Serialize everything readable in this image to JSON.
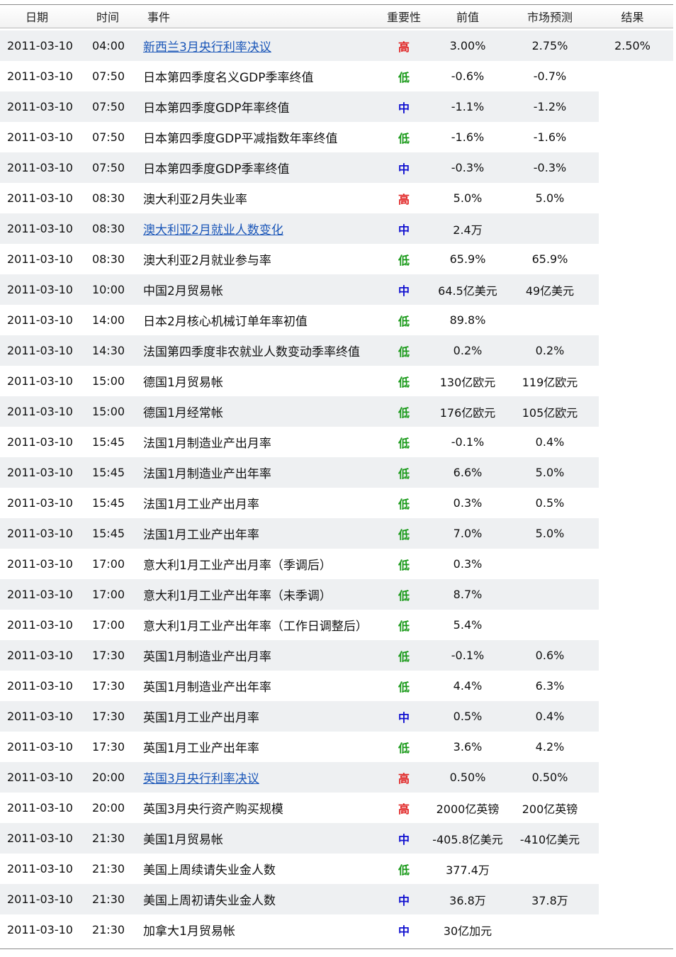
{
  "colors": {
    "high": "#e02020",
    "medium": "#1010d0",
    "low": "#1a9a1a",
    "link": "#1a56b8"
  },
  "columns": {
    "date": "日期",
    "time": "时间",
    "event": "事件",
    "importance": "重要性",
    "previous": "前值",
    "forecast": "市场预测",
    "result": "结果"
  },
  "rows": [
    {
      "date": "2011-03-10",
      "time": "04:00",
      "event": "新西兰3月央行利率决议",
      "link": true,
      "importance": "高",
      "level": "high",
      "previous": "3.00%",
      "forecast": "2.75%",
      "result": "2.50%"
    },
    {
      "date": "2011-03-10",
      "time": "07:50",
      "event": "日本第四季度名义GDP季率终值",
      "link": false,
      "importance": "低",
      "level": "low",
      "previous": "-0.6%",
      "forecast": "-0.7%",
      "result": ""
    },
    {
      "date": "2011-03-10",
      "time": "07:50",
      "event": "日本第四季度GDP年率终值",
      "link": false,
      "importance": "中",
      "level": "medium",
      "previous": "-1.1%",
      "forecast": "-1.2%",
      "result": ""
    },
    {
      "date": "2011-03-10",
      "time": "07:50",
      "event": "日本第四季度GDP平减指数年率终值",
      "link": false,
      "importance": "低",
      "level": "low",
      "previous": "-1.6%",
      "forecast": "-1.6%",
      "result": ""
    },
    {
      "date": "2011-03-10",
      "time": "07:50",
      "event": "日本第四季度GDP季率终值",
      "link": false,
      "importance": "中",
      "level": "medium",
      "previous": "-0.3%",
      "forecast": "-0.3%",
      "result": ""
    },
    {
      "date": "2011-03-10",
      "time": "08:30",
      "event": "澳大利亚2月失业率",
      "link": false,
      "importance": "高",
      "level": "high",
      "previous": "5.0%",
      "forecast": "5.0%",
      "result": ""
    },
    {
      "date": "2011-03-10",
      "time": "08:30",
      "event": "澳大利亚2月就业人数变化",
      "link": true,
      "importance": "中",
      "level": "medium",
      "previous": "2.4万",
      "forecast": "",
      "result": ""
    },
    {
      "date": "2011-03-10",
      "time": "08:30",
      "event": "澳大利亚2月就业参与率",
      "link": false,
      "importance": "低",
      "level": "low",
      "previous": "65.9%",
      "forecast": "65.9%",
      "result": ""
    },
    {
      "date": "2011-03-10",
      "time": "10:00",
      "event": "中国2月贸易帐",
      "link": false,
      "importance": "中",
      "level": "medium",
      "previous": "64.5亿美元",
      "forecast": "49亿美元",
      "result": ""
    },
    {
      "date": "2011-03-10",
      "time": "14:00",
      "event": "日本2月核心机械订单年率初值",
      "link": false,
      "importance": "低",
      "level": "low",
      "previous": "89.8%",
      "forecast": "",
      "result": ""
    },
    {
      "date": "2011-03-10",
      "time": "14:30",
      "event": "法国第四季度非农就业人数变动季率终值",
      "link": false,
      "importance": "低",
      "level": "low",
      "previous": "0.2%",
      "forecast": "0.2%",
      "result": ""
    },
    {
      "date": "2011-03-10",
      "time": "15:00",
      "event": "德国1月贸易帐",
      "link": false,
      "importance": "低",
      "level": "low",
      "previous": "130亿欧元",
      "forecast": "119亿欧元",
      "result": ""
    },
    {
      "date": "2011-03-10",
      "time": "15:00",
      "event": "德国1月经常帐",
      "link": false,
      "importance": "低",
      "level": "low",
      "previous": "176亿欧元",
      "forecast": "105亿欧元",
      "result": ""
    },
    {
      "date": "2011-03-10",
      "time": "15:45",
      "event": "法国1月制造业产出月率",
      "link": false,
      "importance": "低",
      "level": "low",
      "previous": "-0.1%",
      "forecast": "0.4%",
      "result": ""
    },
    {
      "date": "2011-03-10",
      "time": "15:45",
      "event": "法国1月制造业产出年率",
      "link": false,
      "importance": "低",
      "level": "low",
      "previous": "6.6%",
      "forecast": "5.0%",
      "result": ""
    },
    {
      "date": "2011-03-10",
      "time": "15:45",
      "event": "法国1月工业产出月率",
      "link": false,
      "importance": "低",
      "level": "low",
      "previous": "0.3%",
      "forecast": "0.5%",
      "result": ""
    },
    {
      "date": "2011-03-10",
      "time": "15:45",
      "event": "法国1月工业产出年率",
      "link": false,
      "importance": "低",
      "level": "low",
      "previous": "7.0%",
      "forecast": "5.0%",
      "result": ""
    },
    {
      "date": "2011-03-10",
      "time": "17:00",
      "event": "意大利1月工业产出月率（季调后）",
      "link": false,
      "importance": "低",
      "level": "low",
      "previous": "0.3%",
      "forecast": "",
      "result": ""
    },
    {
      "date": "2011-03-10",
      "time": "17:00",
      "event": "意大利1月工业产出年率（未季调）",
      "link": false,
      "importance": "低",
      "level": "low",
      "previous": "8.7%",
      "forecast": "",
      "result": ""
    },
    {
      "date": "2011-03-10",
      "time": "17:00",
      "event": "意大利1月工业产出年率（工作日调整后）",
      "link": false,
      "importance": "低",
      "level": "low",
      "previous": "5.4%",
      "forecast": "",
      "result": ""
    },
    {
      "date": "2011-03-10",
      "time": "17:30",
      "event": "英国1月制造业产出月率",
      "link": false,
      "importance": "低",
      "level": "low",
      "previous": "-0.1%",
      "forecast": "0.6%",
      "result": ""
    },
    {
      "date": "2011-03-10",
      "time": "17:30",
      "event": "英国1月制造业产出年率",
      "link": false,
      "importance": "低",
      "level": "low",
      "previous": "4.4%",
      "forecast": "6.3%",
      "result": ""
    },
    {
      "date": "2011-03-10",
      "time": "17:30",
      "event": "英国1月工业产出月率",
      "link": false,
      "importance": "中",
      "level": "medium",
      "previous": "0.5%",
      "forecast": "0.4%",
      "result": ""
    },
    {
      "date": "2011-03-10",
      "time": "17:30",
      "event": "英国1月工业产出年率",
      "link": false,
      "importance": "低",
      "level": "low",
      "previous": "3.6%",
      "forecast": "4.2%",
      "result": ""
    },
    {
      "date": "2011-03-10",
      "time": "20:00",
      "event": "英国3月央行利率决议",
      "link": true,
      "importance": "高",
      "level": "high",
      "previous": "0.50%",
      "forecast": "0.50%",
      "result": ""
    },
    {
      "date": "2011-03-10",
      "time": "20:00",
      "event": "英国3月央行资产购买规模",
      "link": false,
      "importance": "高",
      "level": "high",
      "previous": "2000亿英镑",
      "forecast": "200亿英镑",
      "result": ""
    },
    {
      "date": "2011-03-10",
      "time": "21:30",
      "event": "美国1月贸易帐",
      "link": false,
      "importance": "中",
      "level": "medium",
      "previous": "-405.8亿美元",
      "forecast": "-410亿美元",
      "result": ""
    },
    {
      "date": "2011-03-10",
      "time": "21:30",
      "event": "美国上周续请失业金人数",
      "link": false,
      "importance": "低",
      "level": "low",
      "previous": "377.4万",
      "forecast": "",
      "result": ""
    },
    {
      "date": "2011-03-10",
      "time": "21:30",
      "event": "美国上周初请失业金人数",
      "link": false,
      "importance": "中",
      "level": "medium",
      "previous": "36.8万",
      "forecast": "37.8万",
      "result": ""
    },
    {
      "date": "2011-03-10",
      "time": "21:30",
      "event": "加拿大1月贸易帐",
      "link": false,
      "importance": "中",
      "level": "medium",
      "previous": "30亿加元",
      "forecast": "",
      "result": ""
    }
  ]
}
